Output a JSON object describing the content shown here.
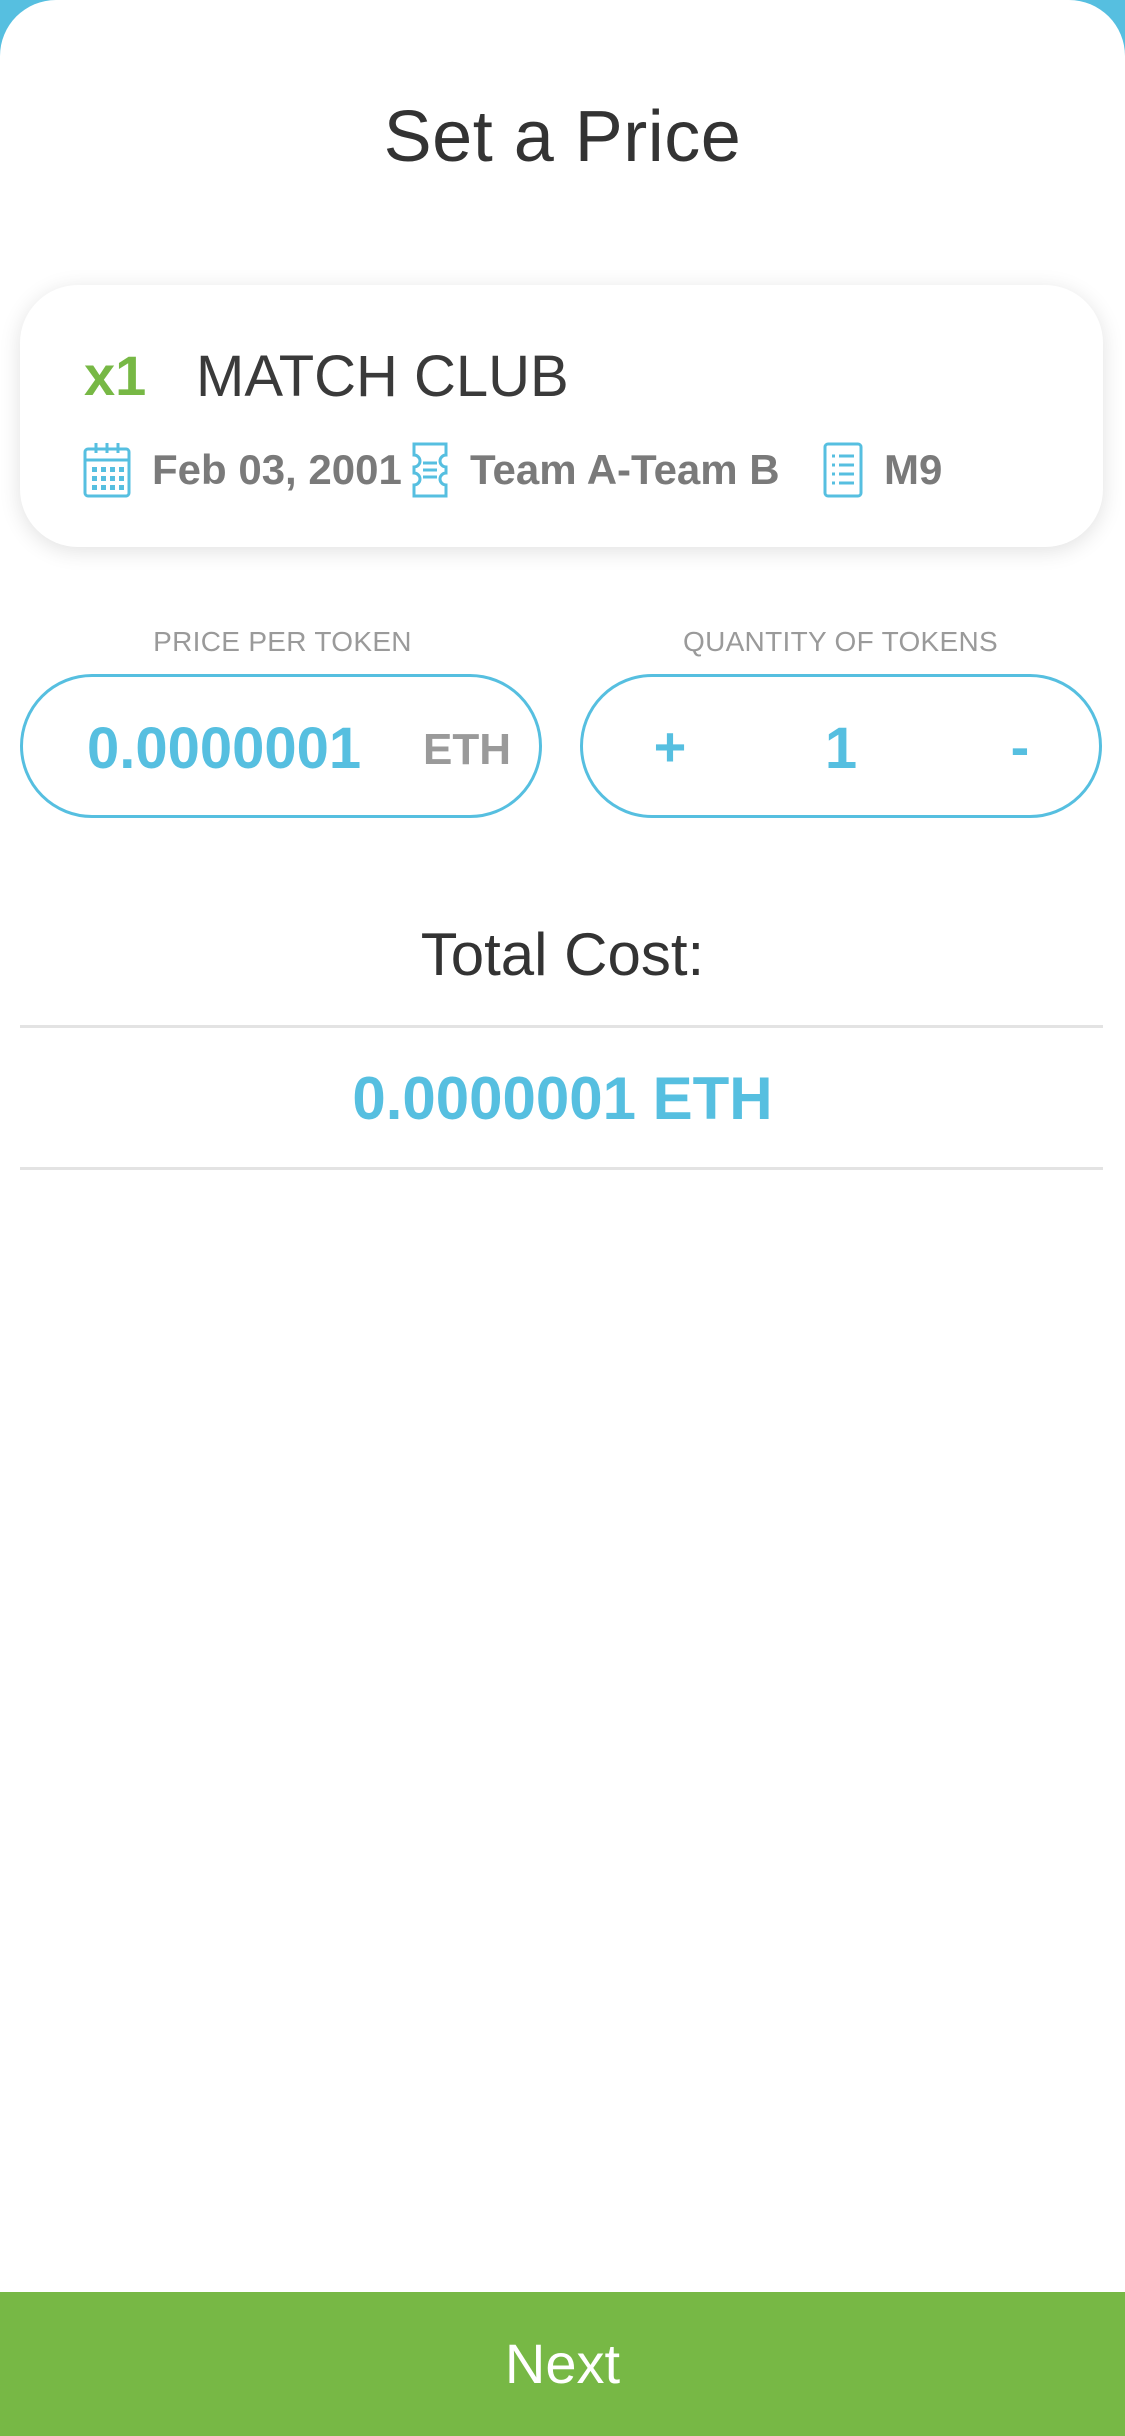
{
  "header": {
    "title": "Set a Price"
  },
  "listing": {
    "quantity_badge": "x1",
    "event_name": "MATCH CLUB",
    "date": "Feb 03, 2001",
    "teams": "Team A-Team B",
    "match_code": "M9"
  },
  "price": {
    "label": "PRICE PER TOKEN",
    "value": "0.0000001",
    "unit": "ETH"
  },
  "quantity": {
    "label": "QUANTITY OF TOKENS",
    "increment": "+",
    "value": "1",
    "decrement": "-"
  },
  "total": {
    "label": "Total Cost:",
    "value": "0.0000001 ETH"
  },
  "footer": {
    "next_label": "Next"
  },
  "icons": {
    "date": "calendar-icon",
    "teams": "ticket-icon",
    "match": "list-icon"
  },
  "colors": {
    "accent_blue": "#56bfe0",
    "accent_green": "#77b845",
    "text_dark": "#333333",
    "text_gray": "#7a7a7a"
  }
}
